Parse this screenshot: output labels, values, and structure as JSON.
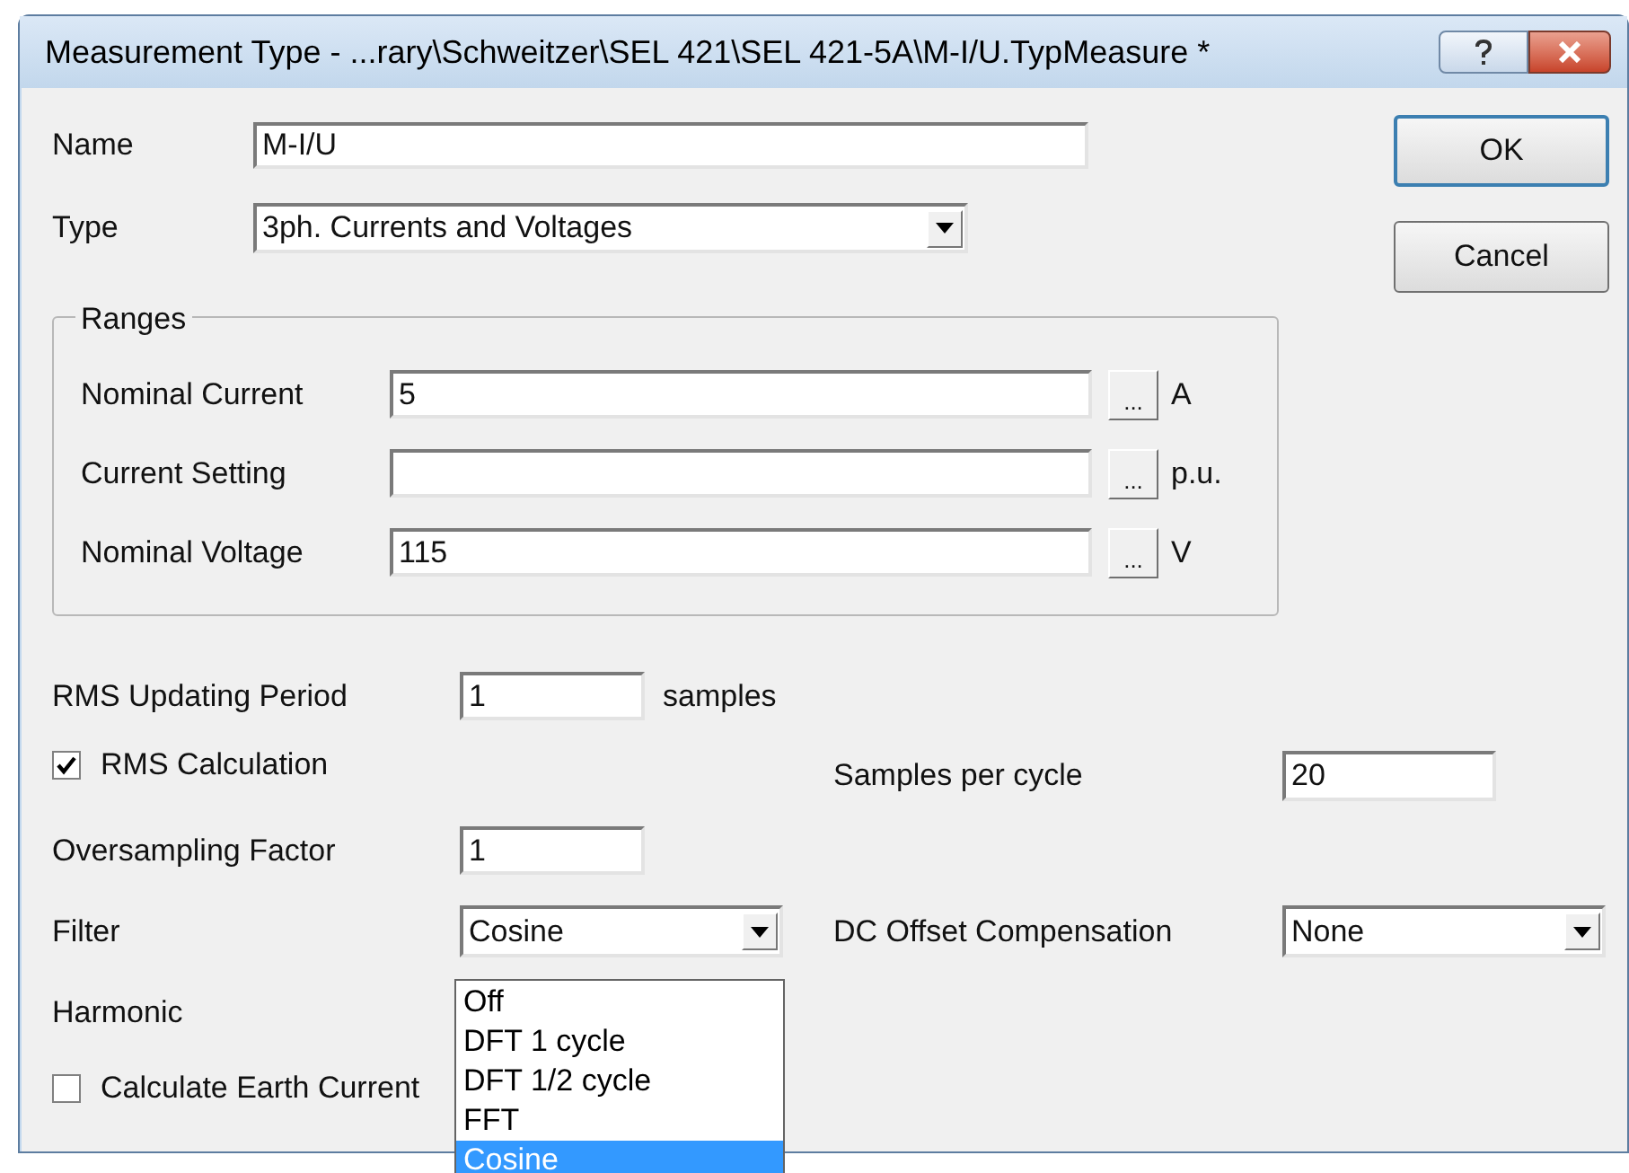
{
  "window": {
    "title": "Measurement Type - ...rary\\Schweitzer\\SEL 421\\SEL 421-5A\\M-I/U.TypMeasure *"
  },
  "name": {
    "label": "Name",
    "value": "M-I/U"
  },
  "type": {
    "label": "Type",
    "value": "3ph. Currents and Voltages"
  },
  "buttons": [
    {
      "label": "OK",
      "default": true
    },
    {
      "label": "Cancel",
      "default": false
    }
  ],
  "ranges": {
    "title": "Ranges",
    "rows": [
      {
        "label": "Nominal Current",
        "value": "5",
        "browse": "...",
        "unit": "A"
      },
      {
        "label": "Current Setting",
        "value": "",
        "browse": "...",
        "unit": "p.u."
      },
      {
        "label": "Nominal Voltage",
        "value": "115",
        "browse": "...",
        "unit": "V"
      }
    ]
  },
  "rms_updating_period": {
    "label": "RMS Updating Period",
    "value": "1",
    "unit": "samples"
  },
  "rms_calculation": {
    "label": "RMS Calculation",
    "checked": true
  },
  "samples_per_cycle": {
    "label": "Samples per cycle",
    "value": "20"
  },
  "oversampling_factor": {
    "label": "Oversampling Factor",
    "value": "1"
  },
  "filter": {
    "label": "Filter",
    "value": "Cosine",
    "expanded": true,
    "options": [
      {
        "label": "Off",
        "selected": false
      },
      {
        "label": "DFT 1 cycle",
        "selected": false
      },
      {
        "label": "DFT 1/2 cycle",
        "selected": false
      },
      {
        "label": "FFT",
        "selected": false
      },
      {
        "label": "Cosine",
        "selected": true
      }
    ]
  },
  "dc_offset_compensation": {
    "label": "DC Offset Compensation",
    "value": "None"
  },
  "harmonic": {
    "label": "Harmonic"
  },
  "calculate_earth_current": {
    "label": "Calculate Earth Current",
    "checked": false
  }
}
